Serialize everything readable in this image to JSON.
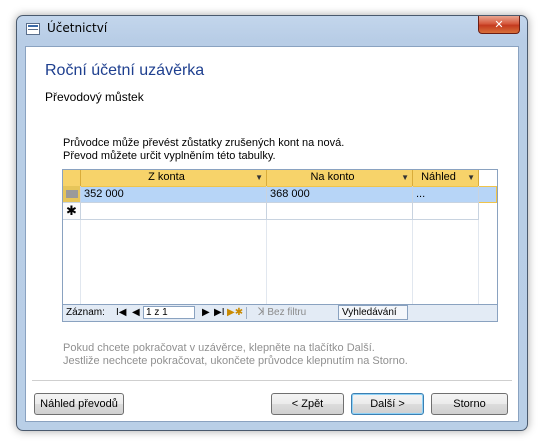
{
  "window": {
    "title": "Účetnictví",
    "close_label": "✕"
  },
  "wizard": {
    "title": "Roční účetní uzávěrka",
    "subtitle": "Převodový můstek",
    "description_line1": "Průvodce může převést zůstatky zrušených kont na nová.",
    "description_line2": "Převod můžete určit vyplněním této tabulky."
  },
  "grid": {
    "columns": [
      "Z konta",
      "Na konto",
      "Náhled"
    ],
    "rows": [
      {
        "from": "352 000",
        "to": "368 000",
        "preview": "..."
      }
    ],
    "new_row_marker": "✱"
  },
  "navigator": {
    "label": "Záznam:",
    "first": "I◀",
    "prev": "◀",
    "record": "1 z 1",
    "next": "▶",
    "last": "▶I",
    "new": "▶✱",
    "filter": "Bez filtru",
    "filter_icon": "ꓘ",
    "search": "Vyhledávání"
  },
  "hints": {
    "line1": "Pokud chcete pokračovat v uzávěrce, klepněte na tlačítko Další.",
    "line2": "Jestliže nechcete pokračovat, ukončete průvodce klepnutím na Storno."
  },
  "buttons": {
    "preview": "Náhled převodů",
    "back": "< Zpět",
    "next": "Další >",
    "cancel": "Storno"
  }
}
